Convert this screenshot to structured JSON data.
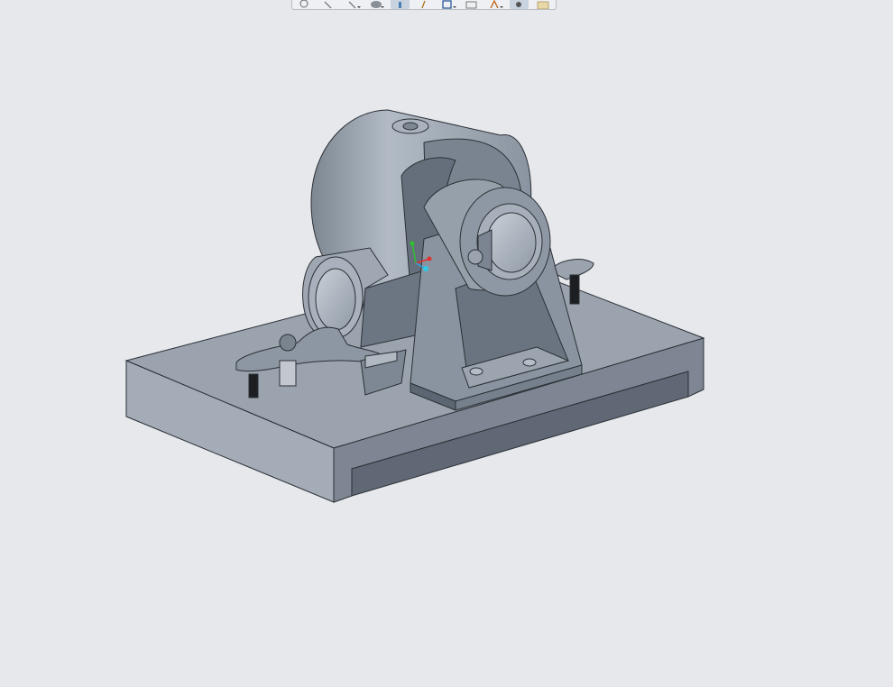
{
  "toolbar": {
    "buttons": [
      {
        "icon": "zoom-in-icon"
      },
      {
        "icon": "zoom-out-icon"
      },
      {
        "icon": "refit-icon"
      },
      {
        "icon": "display-style-icon"
      },
      {
        "icon": "saved-orientations-icon",
        "active": true
      },
      {
        "icon": "datum-display-icon"
      },
      {
        "icon": "view-manager-icon"
      },
      {
        "icon": "section-icon"
      },
      {
        "icon": "annotation-display-icon"
      },
      {
        "icon": "spin-center-icon",
        "active": true
      },
      {
        "icon": "appearance-icon"
      }
    ]
  },
  "model": {
    "colors": {
      "background": "#e6e8ec",
      "body_light": "#a8b1bc",
      "body_mid": "#8e98a4",
      "body_dark": "#6f7884",
      "edge": "#2c3036",
      "axis_x": "#e03030",
      "axis_y": "#30c030",
      "axis_z": "#30a0e0"
    }
  }
}
